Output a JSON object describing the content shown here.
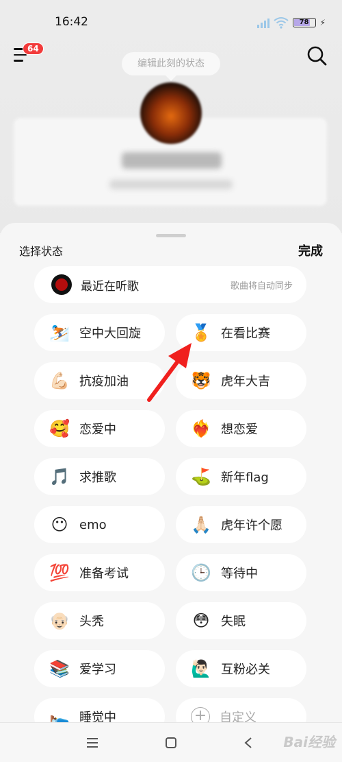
{
  "status_bar": {
    "time": "16:42",
    "battery": "78",
    "icons": [
      "signal-icon",
      "wifi-icon",
      "battery-icon",
      "charging-icon"
    ]
  },
  "header": {
    "menu_badge": "64",
    "status_prompt": "编辑此刻的状态",
    "icons": [
      "menu-icon",
      "search-icon"
    ]
  },
  "sheet": {
    "title": "选择状态",
    "done_label": "完成",
    "music": {
      "label": "最近在听歌",
      "hint": "歌曲将自动同步",
      "icon": "record-icon"
    },
    "statuses": [
      {
        "emoji": "⛷️",
        "label": "空中大回旋"
      },
      {
        "emoji": "🏅",
        "label": "在看比赛"
      },
      {
        "emoji": "💪🏻",
        "label": "抗疫加油"
      },
      {
        "emoji": "🐯",
        "label": "虎年大吉"
      },
      {
        "emoji": "🥰",
        "label": "恋爱中"
      },
      {
        "emoji": "❤️‍🔥",
        "label": "想恋爱"
      },
      {
        "emoji": "🎵",
        "label": "求推歌"
      },
      {
        "emoji": "⛳",
        "label": "新年flag"
      },
      {
        "emoji": "😶",
        "label": "emo"
      },
      {
        "emoji": "🙏🏻",
        "label": "虎年许个愿"
      },
      {
        "emoji": "💯",
        "label": "准备考试"
      },
      {
        "emoji": "🕒",
        "label": "等待中"
      },
      {
        "emoji": "👴🏻",
        "label": "头秃"
      },
      {
        "emoji": "😳",
        "label": "失眠"
      },
      {
        "emoji": "📚",
        "label": "爱学习"
      },
      {
        "emoji": "🙋🏻‍♂️",
        "label": "互粉必关"
      },
      {
        "emoji": "🛌",
        "label": "睡觉中"
      },
      {
        "emoji": "+",
        "label": "自定义"
      }
    ]
  },
  "nav": {
    "icons": [
      "recent-apps-icon",
      "home-icon",
      "back-icon"
    ],
    "watermark": "Bai经验"
  },
  "colors": {
    "accent_red": "#f0201e",
    "badge_red": "#f23b3b"
  }
}
